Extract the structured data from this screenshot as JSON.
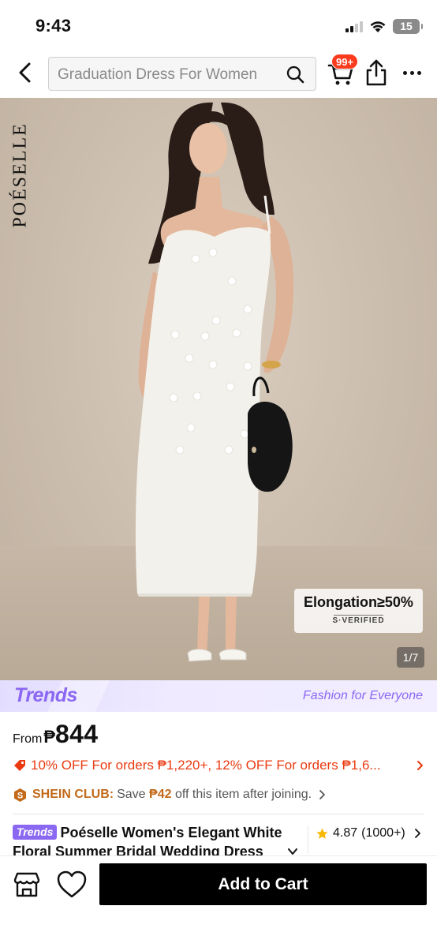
{
  "status_bar": {
    "time": "9:43",
    "battery": "15"
  },
  "nav": {
    "search_placeholder": "Graduation Dress For Women",
    "cart_badge": "99+"
  },
  "hero": {
    "brand_vertical": "POÉSELLE",
    "badge_main": "Elongation≥50%",
    "badge_sub": "S·VERIFIED",
    "image_counter": "1/7"
  },
  "trends_bar": {
    "logo": "Trends",
    "slogan": "Fashion for Everyone"
  },
  "price": {
    "from_label": "From",
    "currency": "₱",
    "value": "844"
  },
  "promo": {
    "text": "10% OFF For orders ₱1,220+,  12% OFF For orders ₱1,6..."
  },
  "club": {
    "name": "SHEIN CLUB:",
    "text_before": "Save",
    "amount": "₱42",
    "text_after": "off this item after joining."
  },
  "product": {
    "trends_chip": "Trends",
    "title": "Poéselle Women's Elegant White Floral Summer Bridal Wedding Dress",
    "rating": "4.87",
    "review_count": "(1000+)"
  },
  "bottom_bar": {
    "add_to_cart": "Add to Cart"
  },
  "colors": {
    "accent_red": "#ea3a10",
    "badge_red": "#fa3b1e",
    "trends_purple": "#8b68f2",
    "club_orange": "#c26a1a",
    "star_yellow": "#f6b800"
  }
}
